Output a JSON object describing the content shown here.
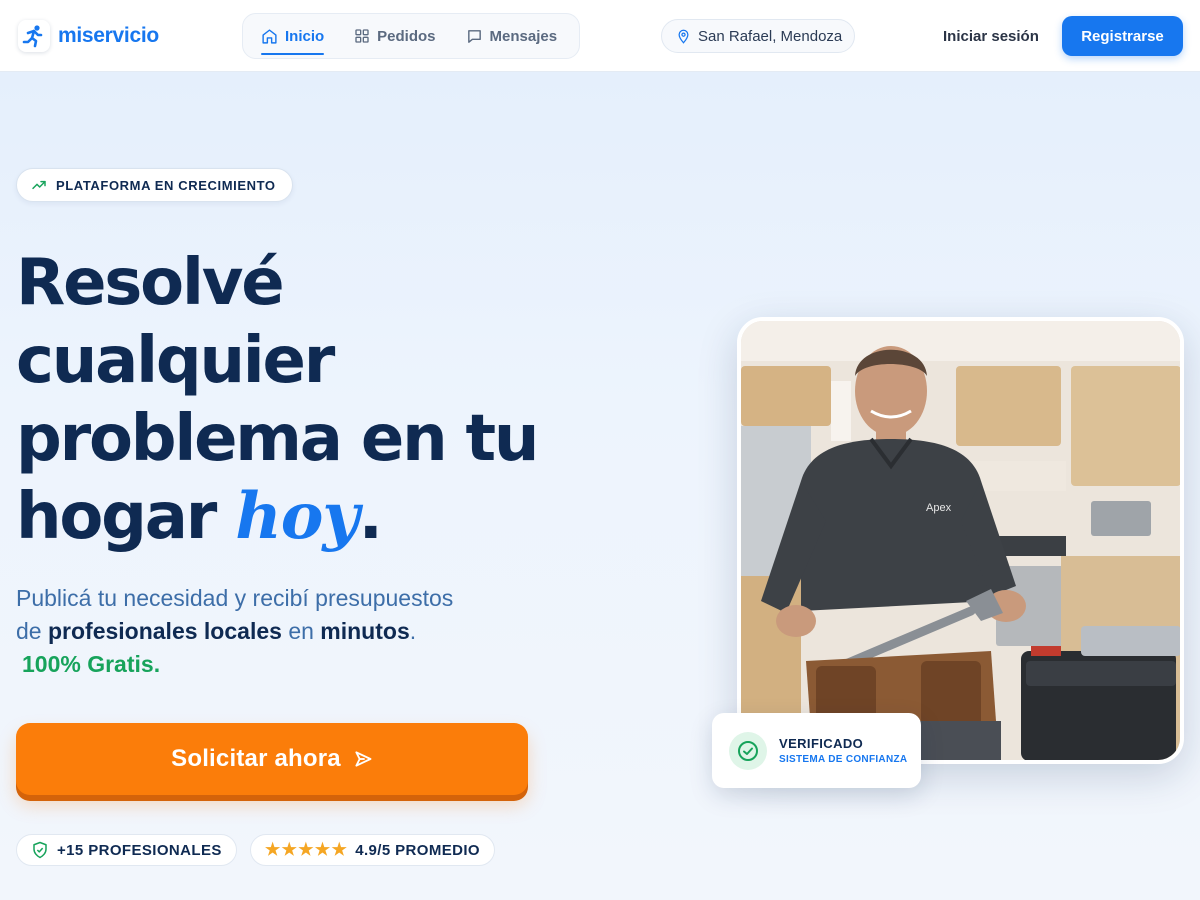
{
  "brand": {
    "name": "miservicio"
  },
  "nav": {
    "items": [
      {
        "label": "Inicio",
        "icon": "home-icon",
        "active": true
      },
      {
        "label": "Pedidos",
        "icon": "grid-icon",
        "active": false
      },
      {
        "label": "Mensajes",
        "icon": "message-icon",
        "active": false
      }
    ]
  },
  "location": {
    "label": "San Rafael, Mendoza",
    "icon": "map-pin-icon"
  },
  "auth": {
    "login_label": "Iniciar sesión",
    "register_label": "Registrarse"
  },
  "hero": {
    "badge": "PLATAFORMA EN CRECIMIENTO",
    "headline_line1": "Resolvé",
    "headline_line2": "cualquier",
    "headline_line3": "problema en tu",
    "headline_line4_main": "hogar",
    "headline_line4_accent": "hoy",
    "headline_line4_dot": ".",
    "sub_part1": "Publicá tu necesidad y recibí presupuestos de",
    "sub_bold1": "profesionales locales",
    "sub_part2": "en",
    "sub_bold2": "minutos",
    "sub_part3": ".",
    "sub_free": "100% Gratis.",
    "cta_label": "Solicitar ahora"
  },
  "stats": {
    "professionals": "+15 PROFESIONALES",
    "rating": "4.9/5 PROMEDIO",
    "rating_stars": 5
  },
  "photo": {
    "shirt_logo": "Apex"
  },
  "verified": {
    "title": "VERIFICADO",
    "subtitle": "SISTEMA DE CONFIANZA"
  },
  "colors": {
    "primary": "#1777ef",
    "navy": "#0f2a52",
    "cta": "#fb7d0a",
    "success": "#17a35b",
    "star": "#f5a623"
  }
}
